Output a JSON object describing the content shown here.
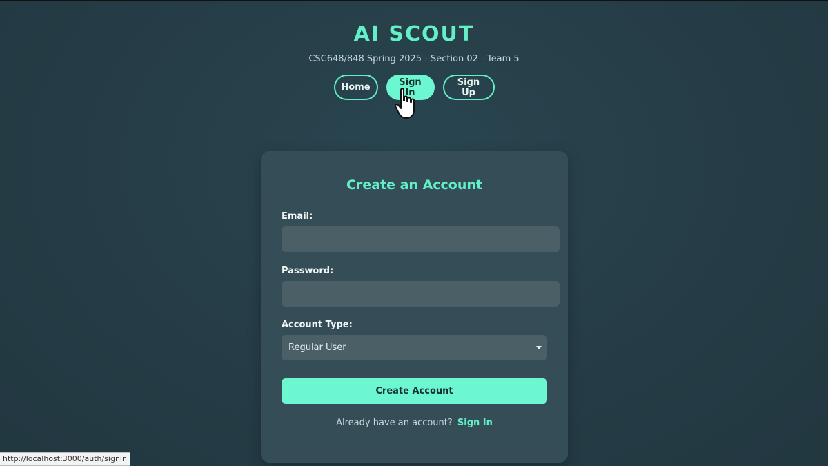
{
  "header": {
    "title": "AI SCOUT",
    "subtitle": "CSC648/848 Spring 2025 - Section 02 - Team 5"
  },
  "nav": {
    "items": [
      {
        "label": "Home",
        "active": false
      },
      {
        "label": "Sign In",
        "active": true
      },
      {
        "label": "Sign Up",
        "active": false
      }
    ]
  },
  "form": {
    "title": "Create an Account",
    "email_label": "Email:",
    "email_value": "",
    "password_label": "Password:",
    "password_value": "",
    "account_type_label": "Account Type:",
    "account_type_selected": "Regular User",
    "submit_label": "Create Account",
    "signin_prompt": "Already have an account?",
    "signin_link": "Sign In"
  },
  "status_bar": {
    "url": "http://localhost:3000/auth/signin"
  },
  "colors": {
    "accent": "#63f0c8",
    "button_fill": "#6cf7d1",
    "card": "#344d57",
    "input": "#4b5f67",
    "background": "#263e48"
  },
  "icons": {
    "cursor": "pointer-hand-icon",
    "select_arrow": "caret-down-icon"
  }
}
